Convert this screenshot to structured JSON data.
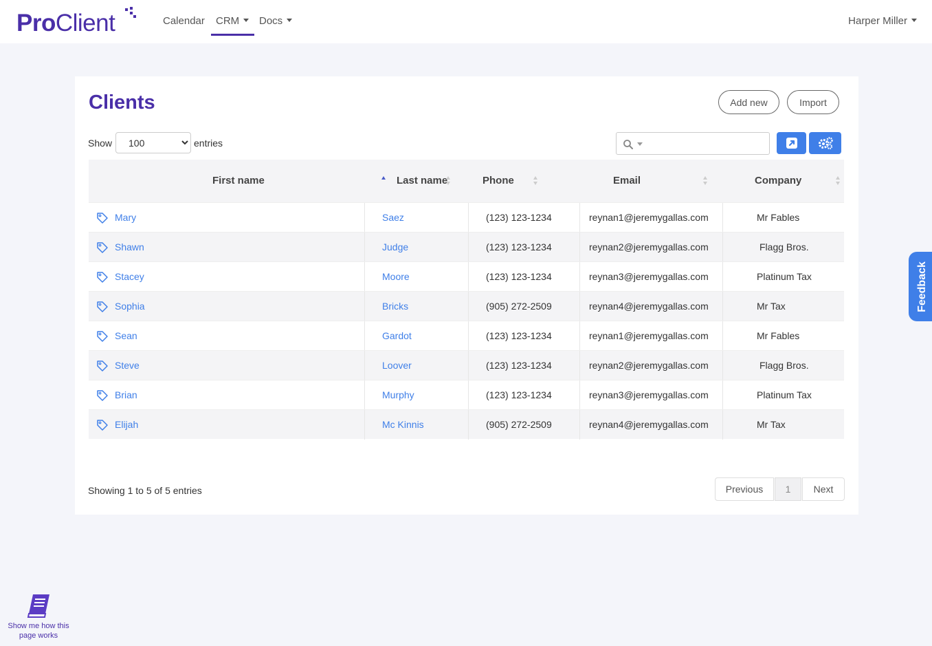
{
  "brand": {
    "pro": "Pro",
    "client": "Client",
    "accent": "#4a2fa8"
  },
  "nav": {
    "calendar": "Calendar",
    "crm": "CRM",
    "docs": "Docs",
    "active": "CRM"
  },
  "user": {
    "name": "Harper Miller"
  },
  "page": {
    "title": "Clients",
    "add_new": "Add new",
    "import": "Import"
  },
  "entries": {
    "show": "Show",
    "value": "100",
    "suffix": "entries"
  },
  "search": {
    "value": "",
    "icon": "search-icon"
  },
  "toolbar": {
    "export_icon": "external-link-icon",
    "settings_icon": "gears-icon",
    "button_color": "#3f7fe8"
  },
  "table": {
    "columns": [
      "First name",
      "Last name",
      "Phone",
      "Email",
      "Company"
    ],
    "sorted_column": "Last name",
    "sort_direction": "ascending",
    "rows": [
      {
        "first": "Mary",
        "last": "Saez",
        "phone": "(123) 123-1234",
        "email": "reynan1@jeremygallas.com",
        "company": "Mr Fables"
      },
      {
        "first": "Shawn",
        "last": "Judge",
        "phone": "(123) 123-1234",
        "email": "reynan2@jeremygallas.com",
        "company": "Flagg Bros."
      },
      {
        "first": "Stacey",
        "last": "Moore",
        "phone": "(123) 123-1234",
        "email": "reynan3@jeremygallas.com",
        "company": "Platinum Tax"
      },
      {
        "first": "Sophia",
        "last": "Bricks",
        "phone": "(905) 272-2509",
        "email": "reynan4@jeremygallas.com",
        "company": "Mr Tax"
      },
      {
        "first": "Sean",
        "last": "Gardot",
        "phone": "(123) 123-1234",
        "email": "reynan1@jeremygallas.com",
        "company": "Mr Fables"
      },
      {
        "first": "Steve",
        "last": "Loover",
        "phone": "(123) 123-1234",
        "email": "reynan2@jeremygallas.com",
        "company": "Flagg Bros."
      },
      {
        "first": "Brian",
        "last": "Murphy",
        "phone": "(123) 123-1234",
        "email": "reynan3@jeremygallas.com",
        "company": "Platinum Tax"
      },
      {
        "first": "Elijah",
        "last": "Mc Kinnis",
        "phone": "(905) 272-2509",
        "email": "reynan4@jeremygallas.com",
        "company": "Mr Tax"
      }
    ]
  },
  "footer": {
    "info": "Showing 1 to 5 of 5 entries",
    "previous": "Previous",
    "page": "1",
    "next": "Next"
  },
  "feedback": {
    "label": "Feedback"
  },
  "help": {
    "label": "Show me how this page works"
  }
}
